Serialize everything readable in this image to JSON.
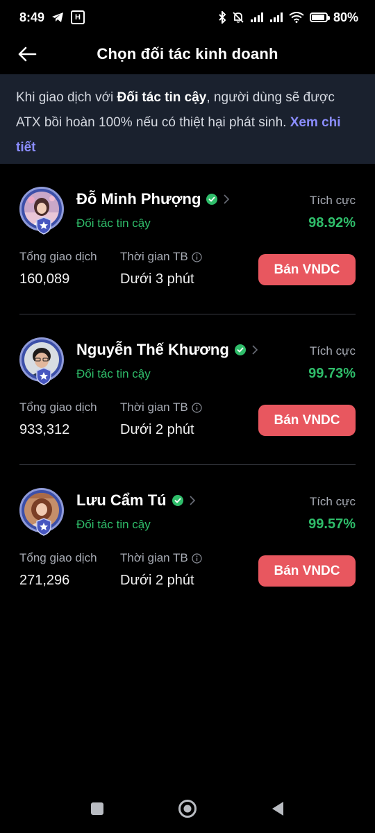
{
  "status_bar": {
    "time": "8:49",
    "battery_text": "80%",
    "battery_level": 0.8
  },
  "header": {
    "title": "Chọn đối tác kinh doanh"
  },
  "banner": {
    "text_before": "Khi giao dịch với ",
    "text_bold": "Đối tác tin cậy",
    "text_after": ", người dùng sẽ được ATX bồi hoàn 100% nếu có thiệt hại phát sinh. ",
    "link_text": "Xem chi tiết"
  },
  "labels": {
    "trusted": "Đối tác tin cậy",
    "positive": "Tích cực",
    "total_trades": "Tổng giao dịch",
    "avg_time": "Thời gian TB",
    "sell_button": "Bán VNDC"
  },
  "partners": [
    {
      "name": "Đỗ Minh Phượng",
      "positive_rate": "98.92%",
      "total_trades": "160,089",
      "avg_time": "Dưới 3 phút"
    },
    {
      "name": "Nguyễn Thế Khương",
      "positive_rate": "99.73%",
      "total_trades": "933,312",
      "avg_time": "Dưới 2 phút"
    },
    {
      "name": "Lưu Cẩm Tú",
      "positive_rate": "99.57%",
      "total_trades": "271,296",
      "avg_time": "Dưới 2 phút"
    }
  ],
  "colors": {
    "background": "#000000",
    "banner_bg": "#1a212e",
    "accent_green": "#2fbd6a",
    "sell_button": "#e8575f",
    "link": "#8b8dff"
  },
  "icons": {
    "back": "arrow-left-icon",
    "verified": "verified-check-icon",
    "chevron": "chevron-right-icon",
    "info": "info-icon"
  }
}
